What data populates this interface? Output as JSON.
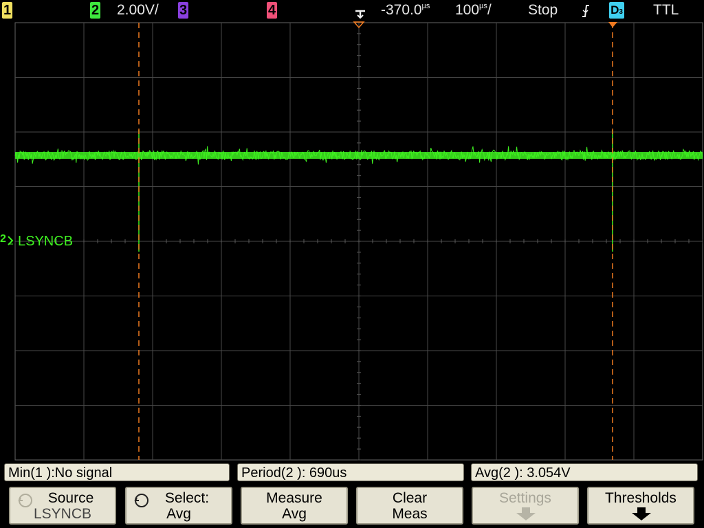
{
  "topbar": {
    "channels": [
      {
        "label": "1",
        "color": "#f0e060"
      },
      {
        "label": "2",
        "color": "#3ee83e"
      },
      {
        "label": "3",
        "color": "#8a40e0"
      },
      {
        "label": "4",
        "color": "#f05078"
      }
    ],
    "ch2_scale": "2.00V/",
    "trigger_delay": "-370.0",
    "trigger_delay_unit": "µs",
    "timebase": "100",
    "timebase_unit": "µs",
    "timebase_suffix": "/",
    "run_state": "Stop",
    "edge_icon": "falling-edge-icon",
    "trigger_source": "D",
    "trigger_source_sub": "3",
    "trigger_source_color": "#40d0f0",
    "threshold": "TTL"
  },
  "screen": {
    "channel_marker": "2",
    "channel_label": "LSYNCB",
    "trace_color": "#3ef020",
    "grid_color": "#4a4a4a",
    "cursor_color": "#f07a20"
  },
  "measurements": [
    {
      "text": "Min(1 ):No signal"
    },
    {
      "text": "Period(2 ): 690us"
    },
    {
      "text": "Avg(2 ): 3.054V"
    }
  ],
  "softkeys": {
    "source": {
      "line1": "Source",
      "line2": "LSYNCB"
    },
    "select": {
      "line1": "Select:",
      "line2": "Avg"
    },
    "measure": {
      "line1": "Measure",
      "line2": "Avg"
    },
    "clear": {
      "line1": "Clear",
      "line2": "Meas"
    },
    "settings": {
      "line1": "Settings"
    },
    "thresholds": {
      "line1": "Thresholds"
    }
  }
}
